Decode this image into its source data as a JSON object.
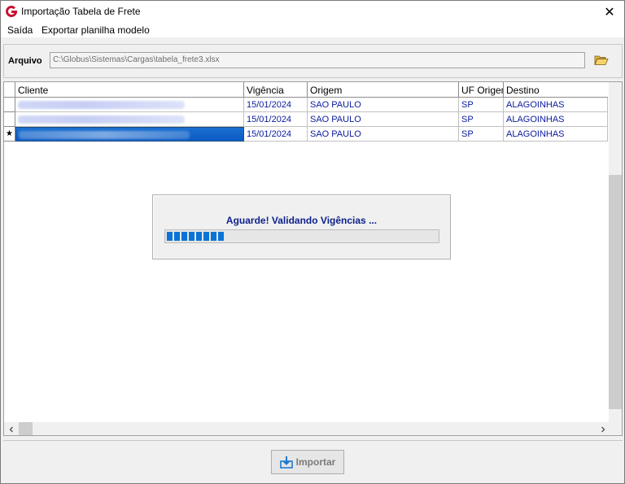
{
  "window": {
    "title": "Importação Tabela de Frete",
    "close_glyph": "✕"
  },
  "menu": {
    "items": [
      "Saída",
      "Exportar planilha modelo"
    ]
  },
  "file": {
    "label": "Arquivo",
    "path": "C:\\Globus\\Sistemas\\Cargas\\tabela_frete3.xlsx",
    "browse_icon": "folder-open-icon"
  },
  "grid": {
    "columns": [
      "Cliente",
      "Vigência",
      "Origem",
      "UF Origem",
      "Destino"
    ],
    "rows": [
      {
        "indicator": "",
        "cliente": "",
        "vigencia": "15/01/2024",
        "origem": "SAO PAULO",
        "uf_origem": "SP",
        "destino": "ALAGOINHAS"
      },
      {
        "indicator": "",
        "cliente": "",
        "vigencia": "15/01/2024",
        "origem": "SAO PAULO",
        "uf_origem": "SP",
        "destino": "ALAGOINHAS"
      },
      {
        "indicator": "★",
        "cliente": "",
        "vigencia": "15/01/2024",
        "origem": "SAO PAULO",
        "uf_origem": "SP",
        "destino": "ALAGOINHAS"
      }
    ],
    "selected_row": 2
  },
  "progress": {
    "message": "Aguarde! Validando Vigências ...",
    "fraction": 0.21
  },
  "footer": {
    "import_label": "Importar",
    "import_enabled": false
  },
  "colors": {
    "cell_text": "#0a1a9e",
    "progress": "#0a74d6",
    "selection": "#0c5bc4",
    "logo": "#c8102e"
  }
}
